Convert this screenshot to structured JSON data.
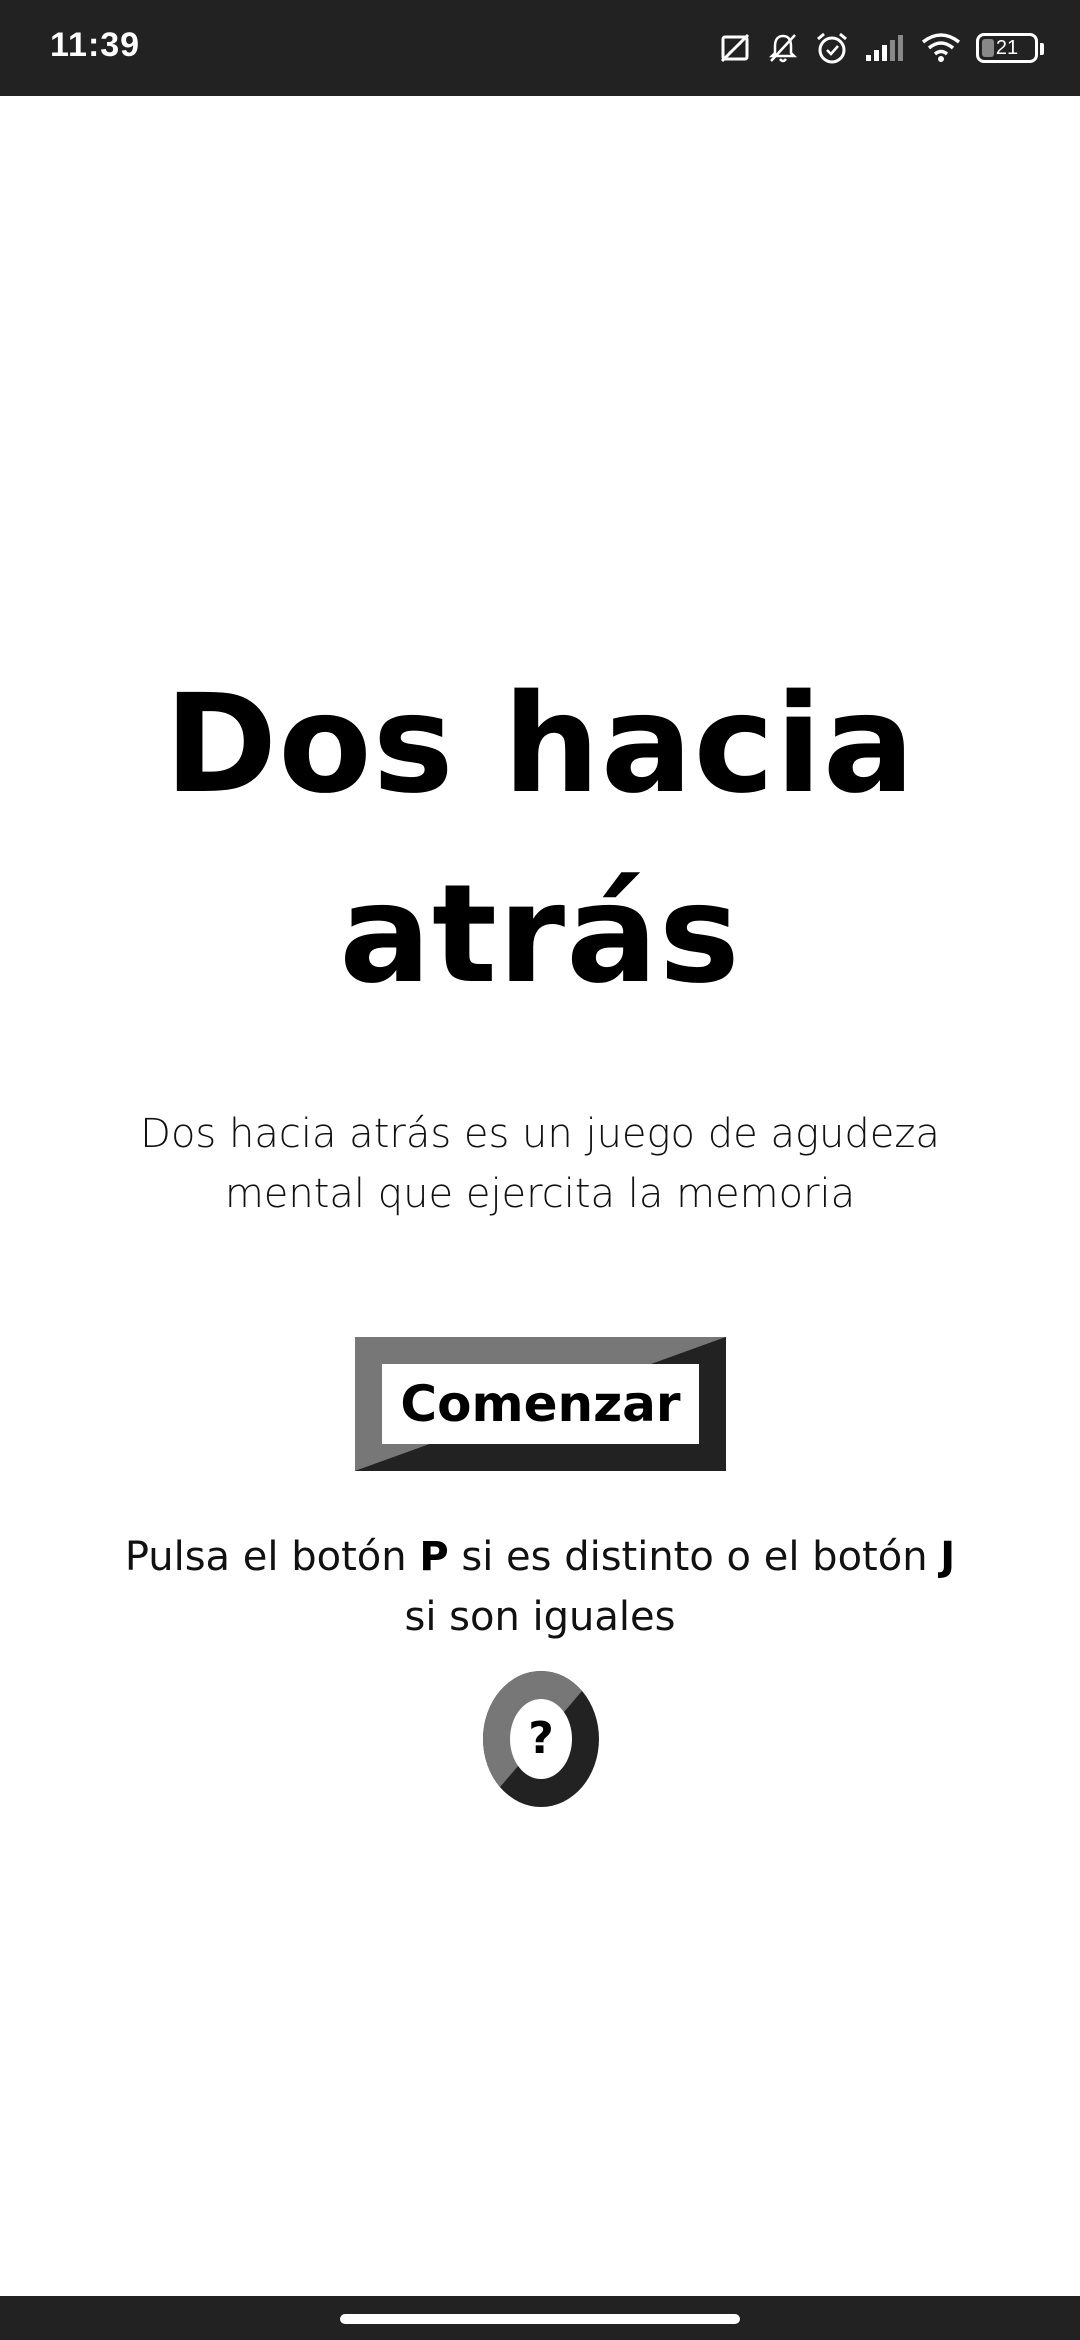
{
  "status_bar": {
    "time": "11:39",
    "battery_level": "21",
    "icons": [
      "no-screenshot-icon",
      "notifications-off-icon",
      "alarm-icon",
      "cell-signal-icon",
      "wifi-icon",
      "battery-icon"
    ]
  },
  "main": {
    "title_line1": "Dos hacia",
    "title_line2": "atrás",
    "description_line1": "Dos hacia atrás es un juego de agudeza",
    "description_line2": "mental que ejercita la memoria",
    "start_button_label": "Comenzar",
    "instructions": {
      "part1": "Pulsa el botón ",
      "key_p": "P",
      "part2": " si es distinto o el botón ",
      "key_j": "J",
      "part3": "si son iguales"
    },
    "help_button_label": "?"
  },
  "colors": {
    "status_bar_bg": "#222222",
    "button_dark": "#222222",
    "button_light": "#777777",
    "text": "#000000",
    "background": "#ffffff"
  }
}
